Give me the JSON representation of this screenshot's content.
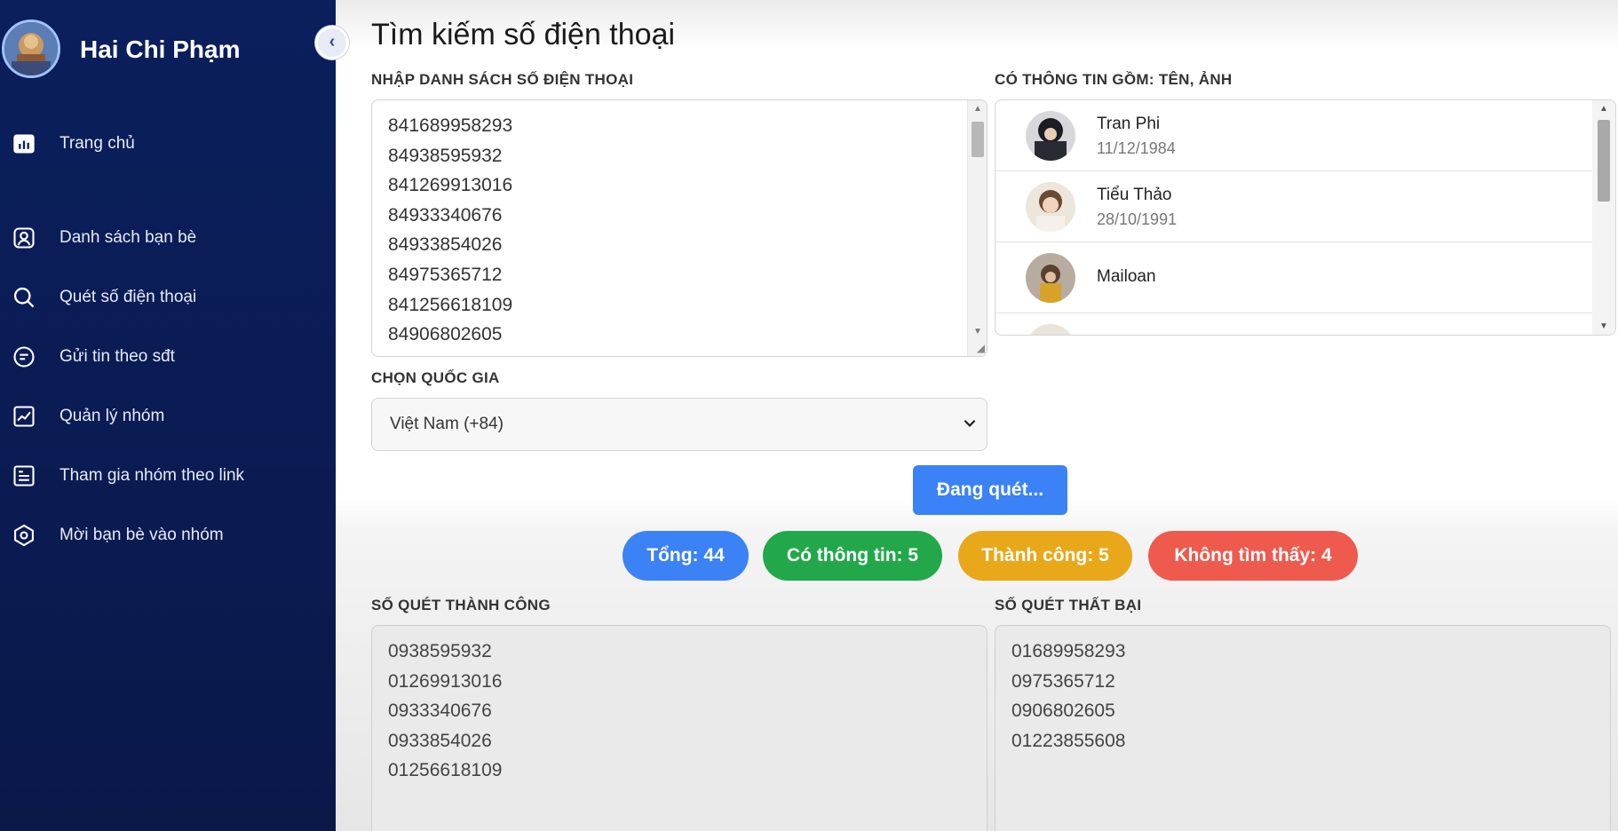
{
  "sidebar": {
    "user_name": "Hai Chi Phạm",
    "items": [
      {
        "label": "Trang chủ",
        "icon": "bar-chart-icon"
      },
      {
        "label": "Danh sách bạn bè",
        "icon": "user-card-icon"
      },
      {
        "label": "Quét số điện thoại",
        "icon": "search-icon"
      },
      {
        "label": "Gửi tin theo sđt",
        "icon": "chat-icon"
      },
      {
        "label": "Quản lý nhóm",
        "icon": "line-chart-icon"
      },
      {
        "label": "Tham gia nhóm theo link",
        "icon": "document-icon"
      },
      {
        "label": "Mời bạn bè vào nhóm",
        "icon": "hexagon-icon"
      }
    ]
  },
  "main": {
    "title": "Tìm kiếm số điện thoại",
    "input_label": "NHẬP DANH SÁCH SỐ ĐIỆN THOẠI",
    "input_numbers": [
      "841689958293",
      "84938595932",
      "841269913016",
      "84933340676",
      "84933854026",
      "84975365712",
      "841256618109",
      "84906802605"
    ],
    "profiles_label": "CÓ THÔNG TIN GỒM: TÊN, ẢNH",
    "profiles": [
      {
        "name": "Tran Phi",
        "dob": "11/12/1984"
      },
      {
        "name": "Tiểu Thảo",
        "dob": "28/10/1991"
      },
      {
        "name": "Mailoan",
        "dob": ""
      }
    ],
    "country_label": "CHỌN QUỐC GIA",
    "country_value": "Việt Nam (+84)",
    "scan_button": "Đang quét...",
    "stats": {
      "total": "Tổng: 44",
      "has_info": "Có thông tin: 5",
      "success": "Thành công: 5",
      "not_found": "Không tìm thấy: 4"
    },
    "success_label": "SỐ QUÉT THÀNH CÔNG",
    "success_numbers": [
      "0938595932",
      "01269913016",
      "0933340676",
      "0933854026",
      "01256618109"
    ],
    "failed_label": "SỐ QUÉT THẤT BẠI",
    "failed_numbers": [
      "01689958293",
      "0975365712",
      "0906802605",
      "01223855608"
    ]
  },
  "colors": {
    "sidebar": "#0a1f5c",
    "primary": "#3b82f6",
    "success": "#22a84a",
    "warning": "#e8a81a",
    "danger": "#ee5a4e"
  }
}
